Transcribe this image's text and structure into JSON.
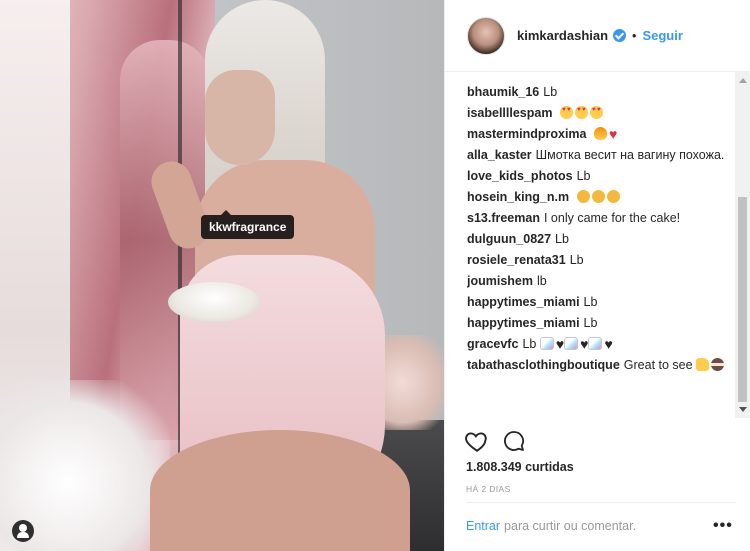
{
  "post": {
    "image_alt": "",
    "photo_tag": "kkwfragrance"
  },
  "header": {
    "username": "kimkardashian",
    "verified": true,
    "separator": "•",
    "follow_label": "Seguir"
  },
  "comments": [
    {
      "user": "bhaumik_16",
      "text": "Lb",
      "emojis": []
    },
    {
      "user": "isabellllespam",
      "text": "",
      "emojis": [
        "heart-eyes",
        "heart-eyes",
        "heart-eyes"
      ]
    },
    {
      "user": "mastermindproxima",
      "text": "",
      "emojis": [
        "fire",
        "red-heart"
      ]
    },
    {
      "user": "alla_kaster",
      "text": "Шмотка весит на вагину похожа.",
      "emojis": []
    },
    {
      "user": "love_kids_photos",
      "text": "Lb",
      "emojis": []
    },
    {
      "user": "hosein_king_n.m",
      "text": "",
      "emojis": [
        "grin",
        "grin",
        "tongue"
      ]
    },
    {
      "user": "s13.freeman",
      "text": "I only came for the cake!",
      "emojis": []
    },
    {
      "user": "dulguun_0827",
      "text": "Lb",
      "emojis": []
    },
    {
      "user": "rosiele_renata31",
      "text": "Lb",
      "emojis": []
    },
    {
      "user": "joumishem",
      "text": "lb",
      "emojis": []
    },
    {
      "user": "happytimes_miami",
      "text": "Lb",
      "emojis": []
    },
    {
      "user": "happytimes_miami",
      "text": "Lb",
      "emojis": []
    },
    {
      "user": "gracevfc",
      "text": "Lb",
      "emojis": [
        "unicorn",
        "black-heart",
        "unicorn",
        "black-heart",
        "unicorn",
        "black-heart"
      ]
    },
    {
      "user": "tabathasclothingboutique",
      "text": "Great to see",
      "emojis": [
        "thumbs-up",
        "cake"
      ]
    }
  ],
  "actions": {
    "likes": "1.808.349 curtidas",
    "time": "HÁ 2 DIAS"
  },
  "footer": {
    "login_link": "Entrar",
    "login_text": "para curtir ou comentar.",
    "more_label": "•••"
  },
  "colors": {
    "accent": "#3897f0",
    "text": "#262626",
    "muted": "#999999",
    "border": "#efefef"
  }
}
